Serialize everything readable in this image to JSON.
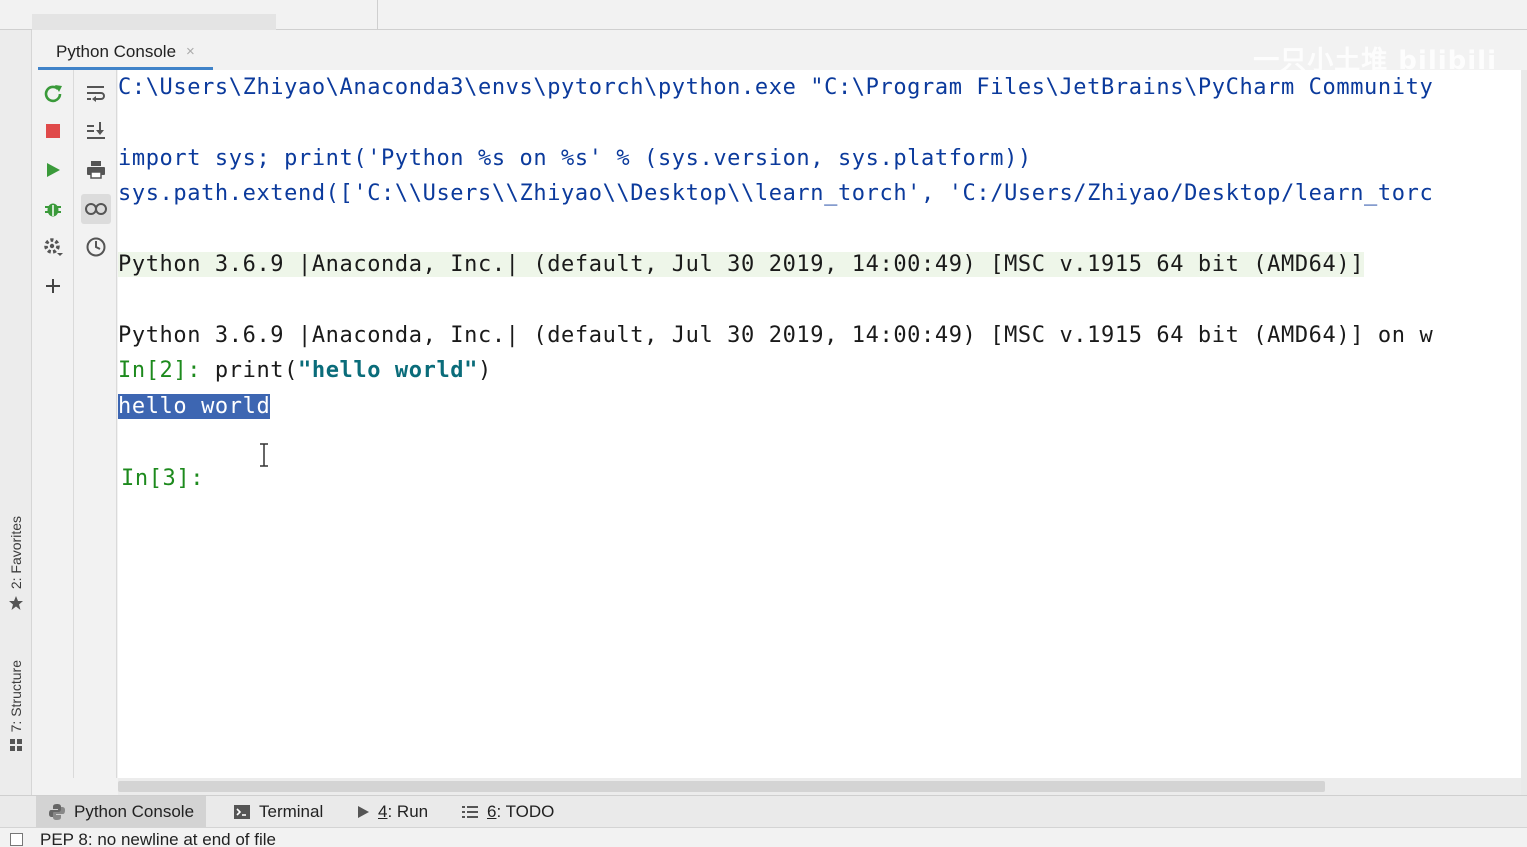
{
  "tool_window": {
    "tab_title": "Python Console",
    "tab_close": "×",
    "watermark": "一只小土堆 bilibili"
  },
  "left_stripe": {
    "favorites": "2: Favorites",
    "structure": "7: Structure"
  },
  "toolbar_left": [
    {
      "icon": "rerun-icon",
      "color": "#3a9a3a"
    },
    {
      "icon": "stop-icon",
      "color": "#e04a4a"
    },
    {
      "icon": "execute-icon",
      "color": "#3a9a3a"
    },
    {
      "icon": "debug-icon",
      "color": "#3a9a3a"
    },
    {
      "icon": "settings-icon",
      "color": "#555555"
    },
    {
      "icon": "new-console-icon",
      "color": "#444444"
    }
  ],
  "toolbar_right": [
    {
      "icon": "soft-wrap-icon"
    },
    {
      "icon": "scroll-to-end-icon"
    },
    {
      "icon": "print-icon"
    },
    {
      "icon": "show-variables-icon"
    },
    {
      "icon": "history-icon"
    }
  ],
  "console": {
    "command_line": "C:\\Users\\Zhiyao\\Anaconda3\\envs\\pytorch\\python.exe \"C:\\Program Files\\JetBrains\\PyCharm Community",
    "import_line": "import sys; print('Python %s on %s' % (sys.version, sys.platform))",
    "path_line": "sys.path.extend(['C:\\\\Users\\\\Zhiyao\\\\Desktop\\\\learn_torch', 'C:/Users/Zhiyao/Desktop/learn_torc",
    "banner": "Python 3.6.9 |Anaconda, Inc.| (default, Jul 30 2019, 14:00:49) [MSC v.1915 64 bit (AMD64)]",
    "version_line": "Python 3.6.9 |Anaconda, Inc.| (default, Jul 30 2019, 14:00:49) [MSC v.1915 64 bit (AMD64)] on w",
    "prompt2": "In[2]: ",
    "input2_fn_open": "print(",
    "input2_str": "\"hello world\"",
    "input2_close": ")",
    "output2": "hello world",
    "prompt3": "In[3]: "
  },
  "bottom_tabs": {
    "python_console": "Python Console",
    "terminal": "Terminal",
    "run_num": "4",
    "run_label": ": Run",
    "todo_num": "6",
    "todo_label": ": TODO"
  },
  "status": {
    "message": "PEP 8: no newline at end of file"
  }
}
